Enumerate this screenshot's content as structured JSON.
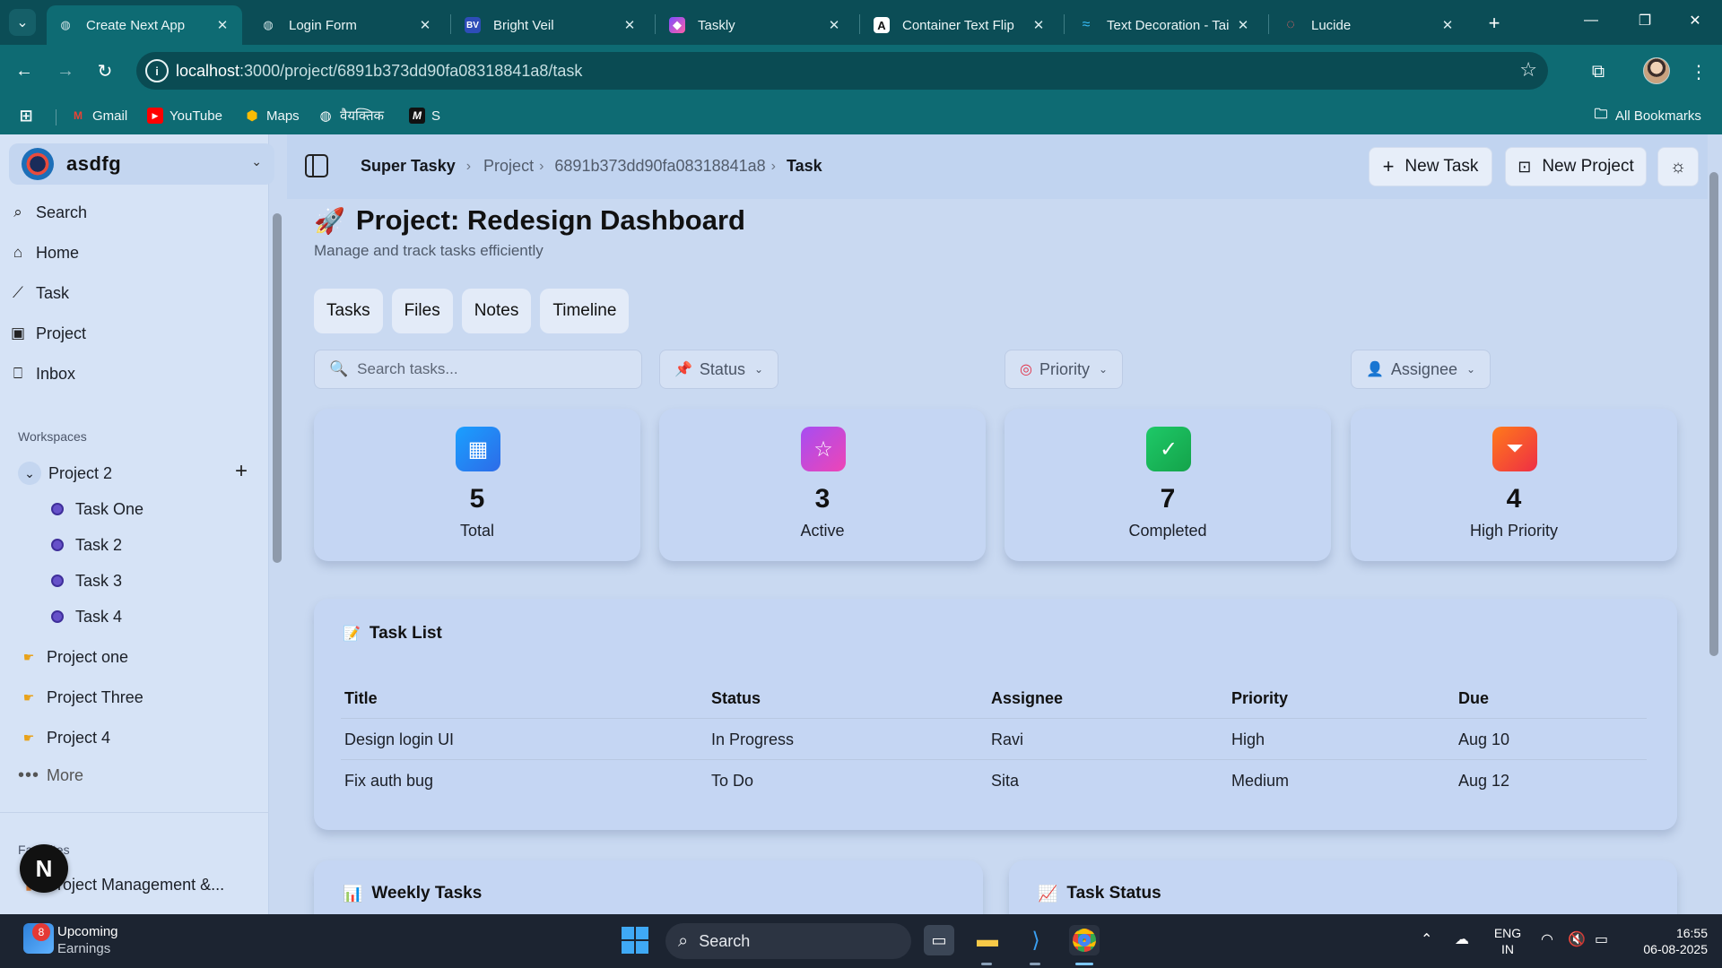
{
  "browser": {
    "tabs": [
      {
        "title": "Create Next App",
        "icon": "globe-icon",
        "active": true
      },
      {
        "title": "Login Form",
        "icon": "globe-icon"
      },
      {
        "title": "Bright Veil",
        "icon": "bv-icon"
      },
      {
        "title": "Taskly",
        "icon": "stack-icon"
      },
      {
        "title": "Container Text Flip",
        "icon": "aceternity-icon"
      },
      {
        "title": "Text Decoration - Tai",
        "icon": "tailwind-icon"
      },
      {
        "title": "Lucide",
        "icon": "lucide-icon"
      }
    ],
    "url_host": "localhost",
    "url_path": ":3000/project/6891b373dd90fa08318841a8/task",
    "bookmarks": [
      {
        "label": "Gmail",
        "icon": "gmail-icon"
      },
      {
        "label": "YouTube",
        "icon": "youtube-icon"
      },
      {
        "label": "Maps",
        "icon": "maps-icon"
      },
      {
        "label": "वैयक्तिक",
        "icon": "globe-icon"
      },
      {
        "label": "S",
        "icon": "m-icon"
      }
    ],
    "all_bookmarks": "All Bookmarks"
  },
  "sidebar": {
    "team_name": "asdfg",
    "nav": [
      {
        "label": "Search",
        "icon": "search-icon"
      },
      {
        "label": "Home",
        "icon": "home-icon"
      },
      {
        "label": "Task",
        "icon": "chart-icon"
      },
      {
        "label": "Project",
        "icon": "project-icon"
      },
      {
        "label": "Inbox",
        "icon": "inbox-icon"
      }
    ],
    "workspaces_label": "Workspaces",
    "project_open": "Project 2",
    "tasks": [
      "Task One",
      "Task 2",
      "Task 3",
      "Task 4"
    ],
    "projects": [
      "Project one",
      "Project Three",
      "Project 4"
    ],
    "more": "More",
    "favorites_label": "Favorites",
    "favorite_item": "Project Management &...",
    "fab_letter": "N"
  },
  "header": {
    "crumb_root": "Super Tasky",
    "crumb_project": "Project",
    "crumb_id": "6891b373dd90fa08318841a8",
    "crumb_current": "Task",
    "new_task": "New Task",
    "new_project": "New Project"
  },
  "page": {
    "title": "Project: Redesign Dashboard",
    "subtitle": "Manage and track tasks efficiently",
    "tabs": [
      "Tasks",
      "Files",
      "Notes",
      "Timeline"
    ],
    "search_placeholder": "Search tasks...",
    "filters": {
      "status": "Status",
      "priority": "Priority",
      "assignee": "Assignee"
    },
    "stats": [
      {
        "value": "5",
        "label": "Total",
        "icon": "calendar-icon",
        "color": "#1f8ef1"
      },
      {
        "value": "3",
        "label": "Active",
        "icon": "star-icon",
        "color": "#c146e0"
      },
      {
        "value": "7",
        "label": "Completed",
        "icon": "check-icon",
        "color": "#22b85a"
      },
      {
        "value": "4",
        "label": "High Priority",
        "icon": "filter-icon",
        "color": "#f0452b"
      }
    ],
    "task_list": {
      "title": "Task List",
      "columns": [
        "Title",
        "Status",
        "Assignee",
        "Priority",
        "Due"
      ],
      "rows": [
        [
          "Design login UI",
          "In Progress",
          "Ravi",
          "High",
          "Aug 10"
        ],
        [
          "Fix auth bug",
          "To Do",
          "Sita",
          "Medium",
          "Aug 12"
        ]
      ]
    },
    "panels": [
      {
        "title": "Weekly Tasks",
        "icon": "bar-chart-icon"
      },
      {
        "title": "Task Status",
        "icon": "trend-icon"
      }
    ]
  },
  "taskbar": {
    "news_title": "Upcoming",
    "news_sub": "Earnings",
    "badge": "8",
    "search": "Search",
    "lang": "ENG",
    "region": "IN",
    "time": "16:55",
    "date": "06-08-2025"
  }
}
